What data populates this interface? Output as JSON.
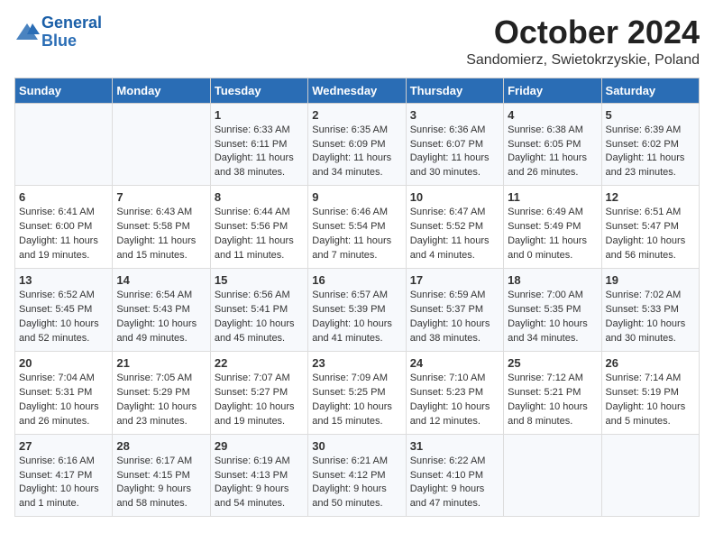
{
  "header": {
    "logo_line1": "General",
    "logo_line2": "Blue",
    "month": "October 2024",
    "location": "Sandomierz, Swietokrzyskie, Poland"
  },
  "days_of_week": [
    "Sunday",
    "Monday",
    "Tuesday",
    "Wednesday",
    "Thursday",
    "Friday",
    "Saturday"
  ],
  "weeks": [
    [
      {
        "day": "",
        "info": ""
      },
      {
        "day": "",
        "info": ""
      },
      {
        "day": "1",
        "info": "Sunrise: 6:33 AM\nSunset: 6:11 PM\nDaylight: 11 hours and 38 minutes."
      },
      {
        "day": "2",
        "info": "Sunrise: 6:35 AM\nSunset: 6:09 PM\nDaylight: 11 hours and 34 minutes."
      },
      {
        "day": "3",
        "info": "Sunrise: 6:36 AM\nSunset: 6:07 PM\nDaylight: 11 hours and 30 minutes."
      },
      {
        "day": "4",
        "info": "Sunrise: 6:38 AM\nSunset: 6:05 PM\nDaylight: 11 hours and 26 minutes."
      },
      {
        "day": "5",
        "info": "Sunrise: 6:39 AM\nSunset: 6:02 PM\nDaylight: 11 hours and 23 minutes."
      }
    ],
    [
      {
        "day": "6",
        "info": "Sunrise: 6:41 AM\nSunset: 6:00 PM\nDaylight: 11 hours and 19 minutes."
      },
      {
        "day": "7",
        "info": "Sunrise: 6:43 AM\nSunset: 5:58 PM\nDaylight: 11 hours and 15 minutes."
      },
      {
        "day": "8",
        "info": "Sunrise: 6:44 AM\nSunset: 5:56 PM\nDaylight: 11 hours and 11 minutes."
      },
      {
        "day": "9",
        "info": "Sunrise: 6:46 AM\nSunset: 5:54 PM\nDaylight: 11 hours and 7 minutes."
      },
      {
        "day": "10",
        "info": "Sunrise: 6:47 AM\nSunset: 5:52 PM\nDaylight: 11 hours and 4 minutes."
      },
      {
        "day": "11",
        "info": "Sunrise: 6:49 AM\nSunset: 5:49 PM\nDaylight: 11 hours and 0 minutes."
      },
      {
        "day": "12",
        "info": "Sunrise: 6:51 AM\nSunset: 5:47 PM\nDaylight: 10 hours and 56 minutes."
      }
    ],
    [
      {
        "day": "13",
        "info": "Sunrise: 6:52 AM\nSunset: 5:45 PM\nDaylight: 10 hours and 52 minutes."
      },
      {
        "day": "14",
        "info": "Sunrise: 6:54 AM\nSunset: 5:43 PM\nDaylight: 10 hours and 49 minutes."
      },
      {
        "day": "15",
        "info": "Sunrise: 6:56 AM\nSunset: 5:41 PM\nDaylight: 10 hours and 45 minutes."
      },
      {
        "day": "16",
        "info": "Sunrise: 6:57 AM\nSunset: 5:39 PM\nDaylight: 10 hours and 41 minutes."
      },
      {
        "day": "17",
        "info": "Sunrise: 6:59 AM\nSunset: 5:37 PM\nDaylight: 10 hours and 38 minutes."
      },
      {
        "day": "18",
        "info": "Sunrise: 7:00 AM\nSunset: 5:35 PM\nDaylight: 10 hours and 34 minutes."
      },
      {
        "day": "19",
        "info": "Sunrise: 7:02 AM\nSunset: 5:33 PM\nDaylight: 10 hours and 30 minutes."
      }
    ],
    [
      {
        "day": "20",
        "info": "Sunrise: 7:04 AM\nSunset: 5:31 PM\nDaylight: 10 hours and 26 minutes."
      },
      {
        "day": "21",
        "info": "Sunrise: 7:05 AM\nSunset: 5:29 PM\nDaylight: 10 hours and 23 minutes."
      },
      {
        "day": "22",
        "info": "Sunrise: 7:07 AM\nSunset: 5:27 PM\nDaylight: 10 hours and 19 minutes."
      },
      {
        "day": "23",
        "info": "Sunrise: 7:09 AM\nSunset: 5:25 PM\nDaylight: 10 hours and 15 minutes."
      },
      {
        "day": "24",
        "info": "Sunrise: 7:10 AM\nSunset: 5:23 PM\nDaylight: 10 hours and 12 minutes."
      },
      {
        "day": "25",
        "info": "Sunrise: 7:12 AM\nSunset: 5:21 PM\nDaylight: 10 hours and 8 minutes."
      },
      {
        "day": "26",
        "info": "Sunrise: 7:14 AM\nSunset: 5:19 PM\nDaylight: 10 hours and 5 minutes."
      }
    ],
    [
      {
        "day": "27",
        "info": "Sunrise: 6:16 AM\nSunset: 4:17 PM\nDaylight: 10 hours and 1 minute."
      },
      {
        "day": "28",
        "info": "Sunrise: 6:17 AM\nSunset: 4:15 PM\nDaylight: 9 hours and 58 minutes."
      },
      {
        "day": "29",
        "info": "Sunrise: 6:19 AM\nSunset: 4:13 PM\nDaylight: 9 hours and 54 minutes."
      },
      {
        "day": "30",
        "info": "Sunrise: 6:21 AM\nSunset: 4:12 PM\nDaylight: 9 hours and 50 minutes."
      },
      {
        "day": "31",
        "info": "Sunrise: 6:22 AM\nSunset: 4:10 PM\nDaylight: 9 hours and 47 minutes."
      },
      {
        "day": "",
        "info": ""
      },
      {
        "day": "",
        "info": ""
      }
    ]
  ]
}
